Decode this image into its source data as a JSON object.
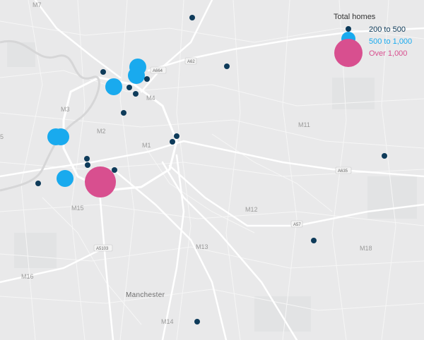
{
  "map": {
    "place_label": "Manchester",
    "district_labels": [
      {
        "text": "M7"
      },
      {
        "text": "M3"
      },
      {
        "text": "M2"
      },
      {
        "text": "M4"
      },
      {
        "text": "M1"
      },
      {
        "text": "M15"
      },
      {
        "text": "M11"
      },
      {
        "text": "M12"
      },
      {
        "text": "M13"
      },
      {
        "text": "M16"
      },
      {
        "text": "M18"
      },
      {
        "text": "M14"
      },
      {
        "text": "5"
      }
    ],
    "road_shields": [
      {
        "text": "A664"
      },
      {
        "text": "A62"
      },
      {
        "text": "A635"
      },
      {
        "text": "A57"
      },
      {
        "text": "A5103"
      }
    ]
  },
  "legend": {
    "title": "Total homes",
    "items": [
      {
        "label": "200 to 500",
        "color": "#0e3b5a"
      },
      {
        "label": "500 to 1,000",
        "color": "#19aaee"
      },
      {
        "label": "Over 1,000",
        "color": "#d84f8f"
      }
    ]
  },
  "markers": [
    {
      "category": 0
    },
    {
      "category": 0
    },
    {
      "category": 0
    },
    {
      "category": 0
    },
    {
      "category": 0
    },
    {
      "category": 0
    },
    {
      "category": 0
    },
    {
      "category": 0
    },
    {
      "category": 0
    },
    {
      "category": 0
    },
    {
      "category": 0
    },
    {
      "category": 0
    },
    {
      "category": 0
    },
    {
      "category": 0
    },
    {
      "category": 0
    },
    {
      "category": 0
    },
    {
      "category": 1
    },
    {
      "category": 1
    },
    {
      "category": 1
    },
    {
      "category": 1
    },
    {
      "category": 1
    },
    {
      "category": 1
    },
    {
      "category": 2
    }
  ]
}
